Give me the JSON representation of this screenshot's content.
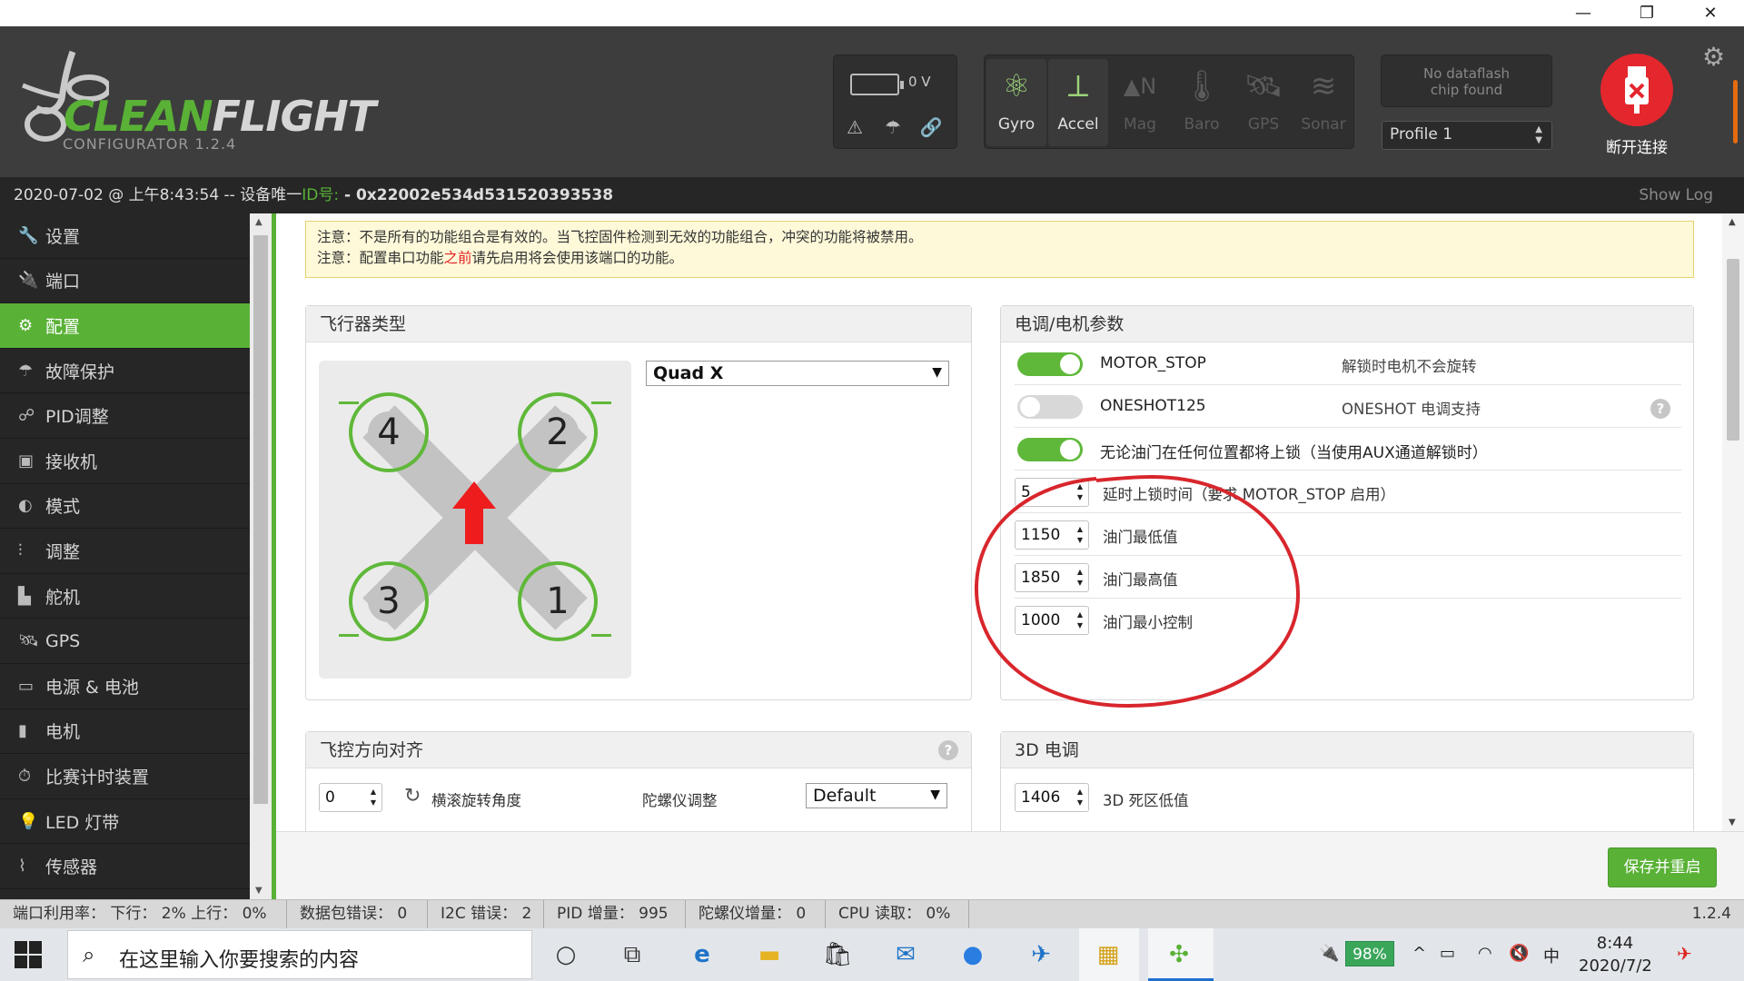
{
  "window": {
    "minimize": "—",
    "restore": "❐",
    "close": "✕"
  },
  "header": {
    "logo_part1": "CLEAN",
    "logo_part2": "FLIGHT",
    "logo_sub": "CONFIGURATOR  1.2.4",
    "battery_voltage": "0 V",
    "sensors": [
      {
        "label": "Gyro",
        "active": true,
        "icon": "gyro-icon"
      },
      {
        "label": "Accel",
        "active": true,
        "icon": "accel-icon"
      },
      {
        "label": "Mag",
        "active": false,
        "icon": "mag-icon"
      },
      {
        "label": "Baro",
        "active": false,
        "icon": "baro-icon"
      },
      {
        "label": "GPS",
        "active": false,
        "icon": "gps-icon"
      },
      {
        "label": "Sonar",
        "active": false,
        "icon": "sonar-icon"
      }
    ],
    "dataflash_line1": "No dataflash",
    "dataflash_line2": "chip found",
    "profile": "Profile 1",
    "disconnect_label": "断开连接"
  },
  "infobar": {
    "date": "2020-07-02 @ 上午8:43:54 -- 设备唯一",
    "id_label": "ID号:",
    "id_value": " - 0x22002e534d531520393538",
    "show_log": "Show Log"
  },
  "sidebar": {
    "items": [
      {
        "label": "设置",
        "icon": "wrench-icon"
      },
      {
        "label": "端口",
        "icon": "plug-icon"
      },
      {
        "label": "配置",
        "icon": "gear-icon",
        "active": true
      },
      {
        "label": "故障保护",
        "icon": "parachute-icon"
      },
      {
        "label": "PID调整",
        "icon": "pid-icon"
      },
      {
        "label": "接收机",
        "icon": "receiver-icon"
      },
      {
        "label": "模式",
        "icon": "modes-icon"
      },
      {
        "label": "调整",
        "icon": "sliders-icon"
      },
      {
        "label": "舵机",
        "icon": "servo-icon"
      },
      {
        "label": "GPS",
        "icon": "satellite-icon"
      },
      {
        "label": "电源 & 电池",
        "icon": "battery-icon"
      },
      {
        "label": "电机",
        "icon": "motor-icon"
      },
      {
        "label": "比赛计时装置",
        "icon": "timer-icon"
      },
      {
        "label": "LED 灯带",
        "icon": "led-icon"
      },
      {
        "label": "传感器",
        "icon": "sensor-icon"
      }
    ]
  },
  "notice": {
    "line1": "注意：不是所有的功能组合是有效的。当飞控固件检测到无效的功能组合，冲突的功能将被禁用。",
    "line2_a": "注意：配置串口功能",
    "line2_red": "之前",
    "line2_b": "请先启用将会使用该端口的功能。"
  },
  "aircraft": {
    "title": "飞行器类型",
    "type": "Quad X",
    "motors": [
      "4",
      "2",
      "3",
      "1"
    ]
  },
  "esc": {
    "title": "电调/电机参数",
    "motor_stop": {
      "label": "MOTOR_STOP",
      "desc": "解锁时电机不会旋转",
      "on": true
    },
    "oneshot": {
      "label": "ONESHOT125",
      "desc": "ONESHOT 电调支持",
      "on": false
    },
    "arm_any": {
      "desc": "无论油门在任何位置都将上锁（当使用AUX通道解锁时）",
      "on": true
    },
    "fields": [
      {
        "value": "5",
        "label": "延时上锁时间（要求 MOTOR_STOP 启用）"
      },
      {
        "value": "1150",
        "label": "油门最低值"
      },
      {
        "value": "1850",
        "label": "油门最高值"
      },
      {
        "value": "1000",
        "label": "油门最小控制"
      }
    ]
  },
  "align": {
    "title": "飞控方向对齐",
    "roll_value": "0",
    "roll_label": "横滚旋转角度",
    "gyro_label": "陀螺仪调整",
    "gyro_select": "Default"
  },
  "esc3d": {
    "title": "3D 电调",
    "deadband_value": "1406",
    "deadband_label": "3D 死区低值"
  },
  "save_button": "保存并重启",
  "statusbar": {
    "port": "端口利用率：  下行：  2% 上行：  0%",
    "packet": "数据包错误：  0",
    "i2c": "I2C 错误：  2",
    "pid": "PID 增量：  995",
    "gyro": "陀螺仪增量：  0",
    "cpu": "CPU 读取：  0%",
    "version": "1.2.4"
  },
  "taskbar": {
    "search_placeholder": "在这里输入你要搜索的内容",
    "battery": "98%",
    "ime": "中",
    "time": "8:44",
    "date": "2020/7/2"
  },
  "colors": {
    "accent": "#59b136",
    "header": "#3d3d3d",
    "disconnect": "#e4262d",
    "annotation": "#d8262c"
  }
}
